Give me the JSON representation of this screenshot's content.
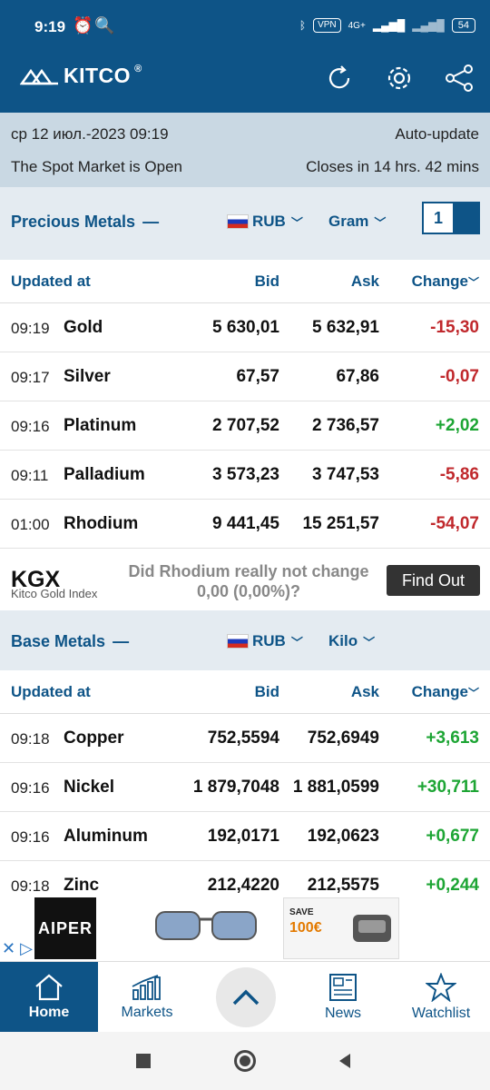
{
  "status_bar": {
    "time": "9:19",
    "vpn": "VPN",
    "network": "4G+",
    "battery": "54"
  },
  "app": {
    "logo_text": "KITCO",
    "logo_mark": "®"
  },
  "info": {
    "datetime": "ср 12 июл.-2023 09:19",
    "auto_update": "Auto-update",
    "market_status": "The Spot Market is Open",
    "closes_in": "Closes in 14 hrs. 42 mins"
  },
  "precious": {
    "title": "Precious Metals",
    "currency": "RUB",
    "unit": "Gram",
    "quantity": "1",
    "headers": {
      "updated": "Updated at",
      "bid": "Bid",
      "ask": "Ask",
      "change": "Change"
    },
    "rows": [
      {
        "time": "09:19",
        "name": "Gold",
        "bid": "5 630,01",
        "ask": "5 632,91",
        "change": "-15,30",
        "dir": "neg"
      },
      {
        "time": "09:17",
        "name": "Silver",
        "bid": "67,57",
        "ask": "67,86",
        "change": "-0,07",
        "dir": "neg"
      },
      {
        "time": "09:16",
        "name": "Platinum",
        "bid": "2 707,52",
        "ask": "2 736,57",
        "change": "+2,02",
        "dir": "pos"
      },
      {
        "time": "09:11",
        "name": "Palladium",
        "bid": "3 573,23",
        "ask": "3 747,53",
        "change": "-5,86",
        "dir": "neg"
      },
      {
        "time": "01:00",
        "name": "Rhodium",
        "bid": "9 441,45",
        "ask": "15 251,57",
        "change": "-54,07",
        "dir": "neg"
      }
    ]
  },
  "kgx": {
    "title": "KGX",
    "subtitle": "Kitco Gold Index",
    "question_line1": "Did Rhodium really not change",
    "question_line2": "0,00 (0,00%)?",
    "button": "Find Out"
  },
  "base": {
    "title": "Base Metals",
    "currency": "RUB",
    "unit": "Kilo",
    "headers": {
      "updated": "Updated at",
      "bid": "Bid",
      "ask": "Ask",
      "change": "Change"
    },
    "rows": [
      {
        "time": "09:18",
        "name": "Copper",
        "bid": "752,5594",
        "ask": "752,6949",
        "change": "+3,613",
        "dir": "pos"
      },
      {
        "time": "09:16",
        "name": "Nickel",
        "bid": "1 879,7048",
        "ask": "1 881,0599",
        "change": "+30,711",
        "dir": "pos"
      },
      {
        "time": "09:16",
        "name": "Aluminum",
        "bid": "192,0171",
        "ask": "192,0623",
        "change": "+0,677",
        "dir": "pos"
      },
      {
        "time": "09:18",
        "name": "Zinc",
        "bid": "212,4220",
        "ask": "212,5575",
        "change": "+0,244",
        "dir": "pos"
      }
    ]
  },
  "ad": {
    "brand": "AIPER",
    "save_label": "SAVE",
    "save_amount": "100€"
  },
  "nav": {
    "home": "Home",
    "markets": "Markets",
    "news": "News",
    "watchlist": "Watchlist"
  },
  "colors": {
    "brand": "#0e5487",
    "negative": "#c0282c",
    "positive": "#1da534"
  }
}
